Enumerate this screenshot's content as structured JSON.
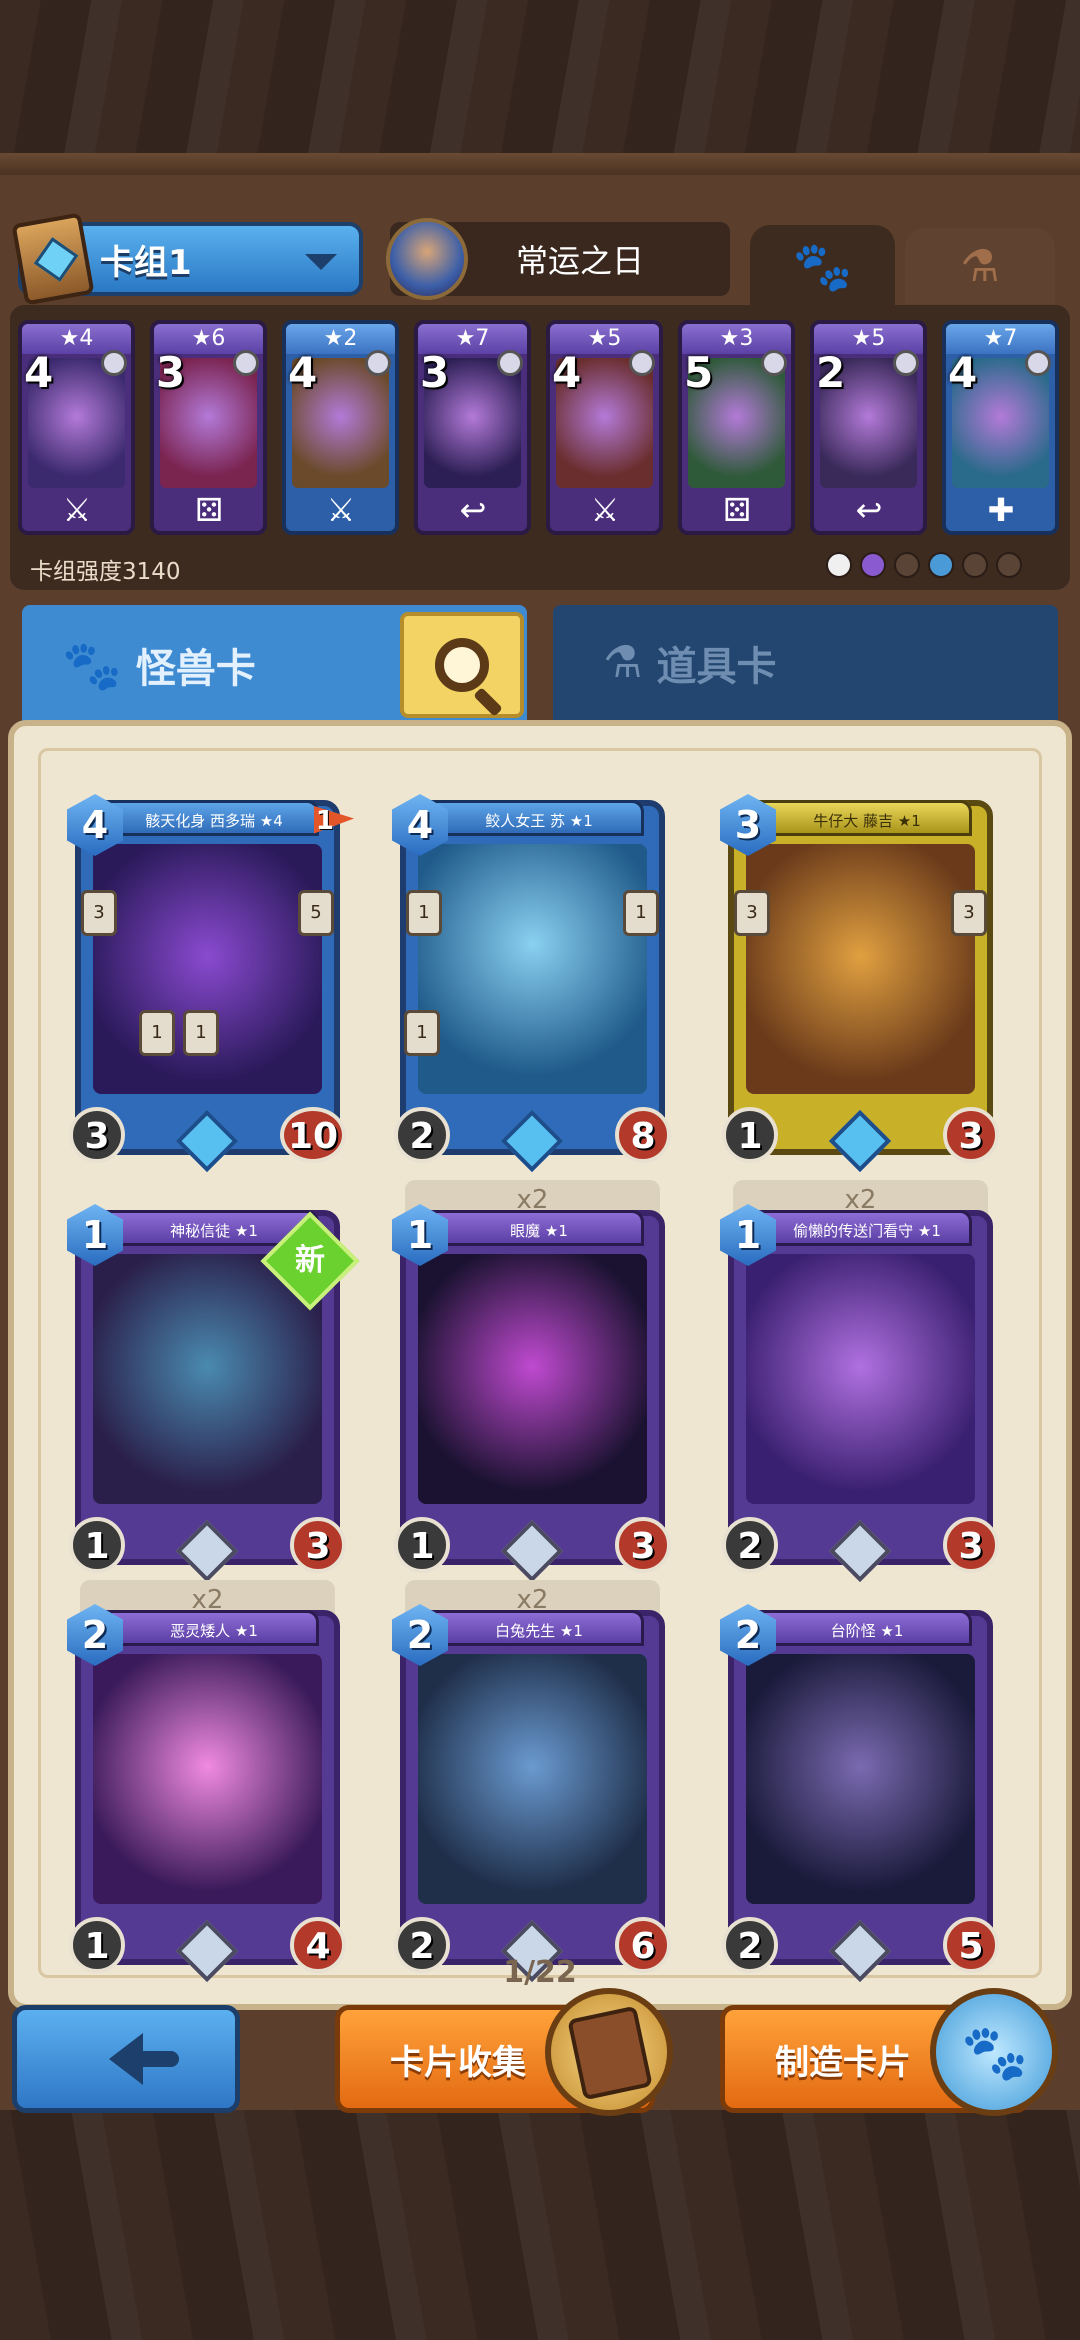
{
  "header": {
    "deck_name": "卡组1",
    "hero_name": "常运之日"
  },
  "deck": {
    "power_label": "卡组强度3140",
    "cards": [
      {
        "stars": "★4",
        "cost": "4",
        "type": "sword",
        "color": "purple"
      },
      {
        "stars": "★6",
        "cost": "3",
        "type": "dice",
        "color": "purple"
      },
      {
        "stars": "★2",
        "cost": "4",
        "type": "sword",
        "color": "blue"
      },
      {
        "stars": "★7",
        "cost": "3",
        "type": "hook",
        "color": "purple"
      },
      {
        "stars": "★5",
        "cost": "4",
        "type": "sword",
        "color": "purple"
      },
      {
        "stars": "★3",
        "cost": "5",
        "type": "dice",
        "color": "purple"
      },
      {
        "stars": "★5",
        "cost": "2",
        "type": "hook",
        "color": "purple"
      },
      {
        "stars": "★7",
        "cost": "4",
        "type": "heal",
        "color": "blue"
      }
    ]
  },
  "tabs": {
    "monster_label": "怪兽卡",
    "item_label": "道具卡"
  },
  "collection": {
    "page": "1/22",
    "cards": [
      {
        "name": "骸天化身 西多瑞 ★4",
        "cost": "4",
        "atk": "3",
        "hp": "10",
        "color": "blue",
        "flag": "1",
        "left_val": "3",
        "right_val": "5",
        "extra_a": "1",
        "extra_b": "1"
      },
      {
        "name": "鲛人女王 苏 ★1",
        "cost": "4",
        "atk": "2",
        "hp": "8",
        "color": "blue",
        "left_val": "1",
        "right_val": "1",
        "extra_a": "1"
      },
      {
        "name": "牛仔大 藤吉 ★1",
        "cost": "3",
        "atk": "1",
        "hp": "3",
        "color": "yellow",
        "left_val": "3",
        "right_val": "3"
      },
      {
        "name": "神秘信徒 ★1",
        "cost": "1",
        "atk": "1",
        "hp": "3",
        "color": "purple",
        "new_badge": "新"
      },
      {
        "name": "眼魔 ★1",
        "cost": "1",
        "atk": "1",
        "hp": "3",
        "color": "purple",
        "count": "x2"
      },
      {
        "name": "偷懒的传送门看守 ★1",
        "cost": "1",
        "atk": "2",
        "hp": "3",
        "color": "purple",
        "count": "x2"
      },
      {
        "name": "恶灵矮人 ★1",
        "cost": "2",
        "atk": "1",
        "hp": "4",
        "color": "purple",
        "count": "x2"
      },
      {
        "name": "白兔先生 ★1",
        "cost": "2",
        "atk": "2",
        "hp": "6",
        "color": "purple",
        "count": "x2"
      },
      {
        "name": "台阶怪 ★1",
        "cost": "2",
        "atk": "2",
        "hp": "5",
        "color": "purple"
      }
    ]
  },
  "buttons": {
    "collect_label": "卡片收集",
    "craft_label": "制造卡片"
  }
}
